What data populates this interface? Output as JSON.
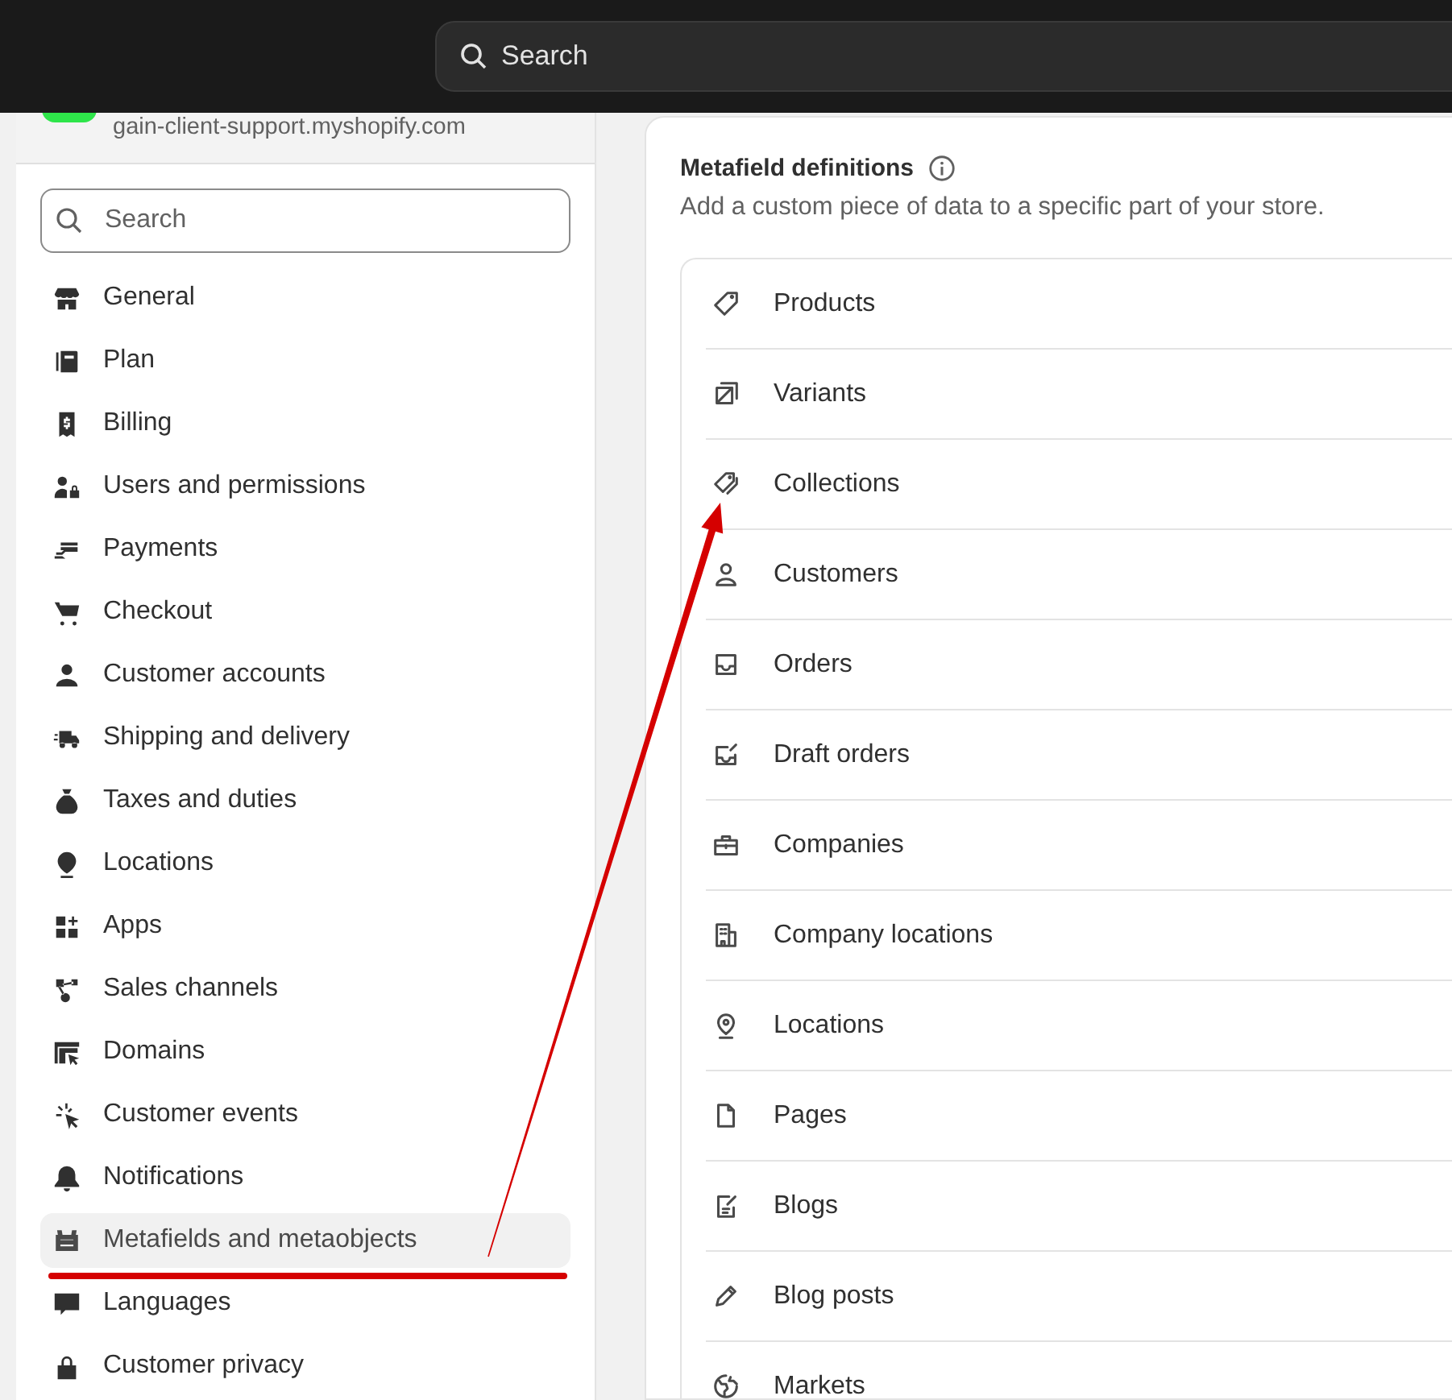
{
  "top_bar": {
    "search": {
      "placeholder": "Search"
    }
  },
  "store": {
    "domain": "gain-client-support.myshopify.com"
  },
  "sidebar": {
    "search": {
      "placeholder": "Search"
    },
    "items": [
      {
        "label": "General",
        "selected": false
      },
      {
        "label": "Plan",
        "selected": false
      },
      {
        "label": "Billing",
        "selected": false
      },
      {
        "label": "Users and permissions",
        "selected": false
      },
      {
        "label": "Payments",
        "selected": false
      },
      {
        "label": "Checkout",
        "selected": false
      },
      {
        "label": "Customer accounts",
        "selected": false
      },
      {
        "label": "Shipping and delivery",
        "selected": false
      },
      {
        "label": "Taxes and duties",
        "selected": false
      },
      {
        "label": "Locations",
        "selected": false
      },
      {
        "label": "Apps",
        "selected": false
      },
      {
        "label": "Sales channels",
        "selected": false
      },
      {
        "label": "Domains",
        "selected": false
      },
      {
        "label": "Customer events",
        "selected": false
      },
      {
        "label": "Notifications",
        "selected": false
      },
      {
        "label": "Metafields and metaobjects",
        "selected": true
      },
      {
        "label": "Languages",
        "selected": false
      },
      {
        "label": "Customer privacy",
        "selected": false
      }
    ]
  },
  "metafields": {
    "title": "Metafield definitions",
    "description": "Add a custom piece of data to a specific part of your store.",
    "items": [
      "Products",
      "Variants",
      "Collections",
      "Customers",
      "Orders",
      "Draft orders",
      "Companies",
      "Company locations",
      "Locations",
      "Pages",
      "Blogs",
      "Blog posts",
      "Markets"
    ]
  }
}
